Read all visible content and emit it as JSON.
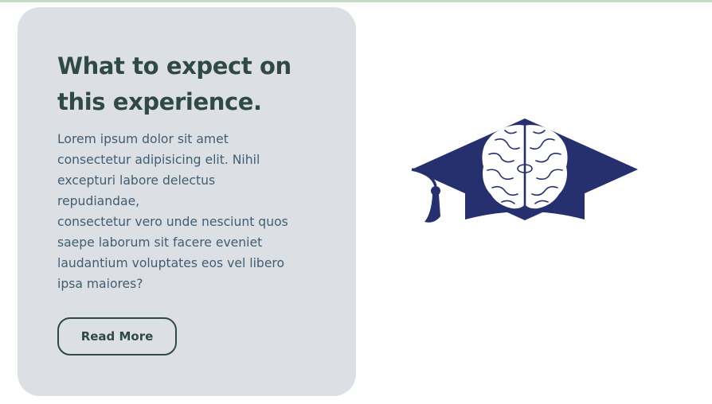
{
  "card": {
    "heading": "What to expect on this experience.",
    "body_lines": [
      "Lorem ipsum dolor sit amet",
      "consectetur adipisicing elit. Nihil",
      "excepturi labore delectus",
      "repudiandae,",
      "consectetur vero unde nesciunt quos",
      "saepe laborum sit facere eveniet",
      "laudantium voluptates eos vel libero",
      "ipsa maiores?"
    ],
    "button_label": "Read More"
  },
  "logo": {
    "icon": "graduation-cap-brain-icon",
    "color": "#26306e"
  },
  "colors": {
    "card_background": "#dce0e4",
    "heading": "#2f4a45",
    "body_text": "#3f5e73",
    "top_border": "#c5dcc8"
  }
}
